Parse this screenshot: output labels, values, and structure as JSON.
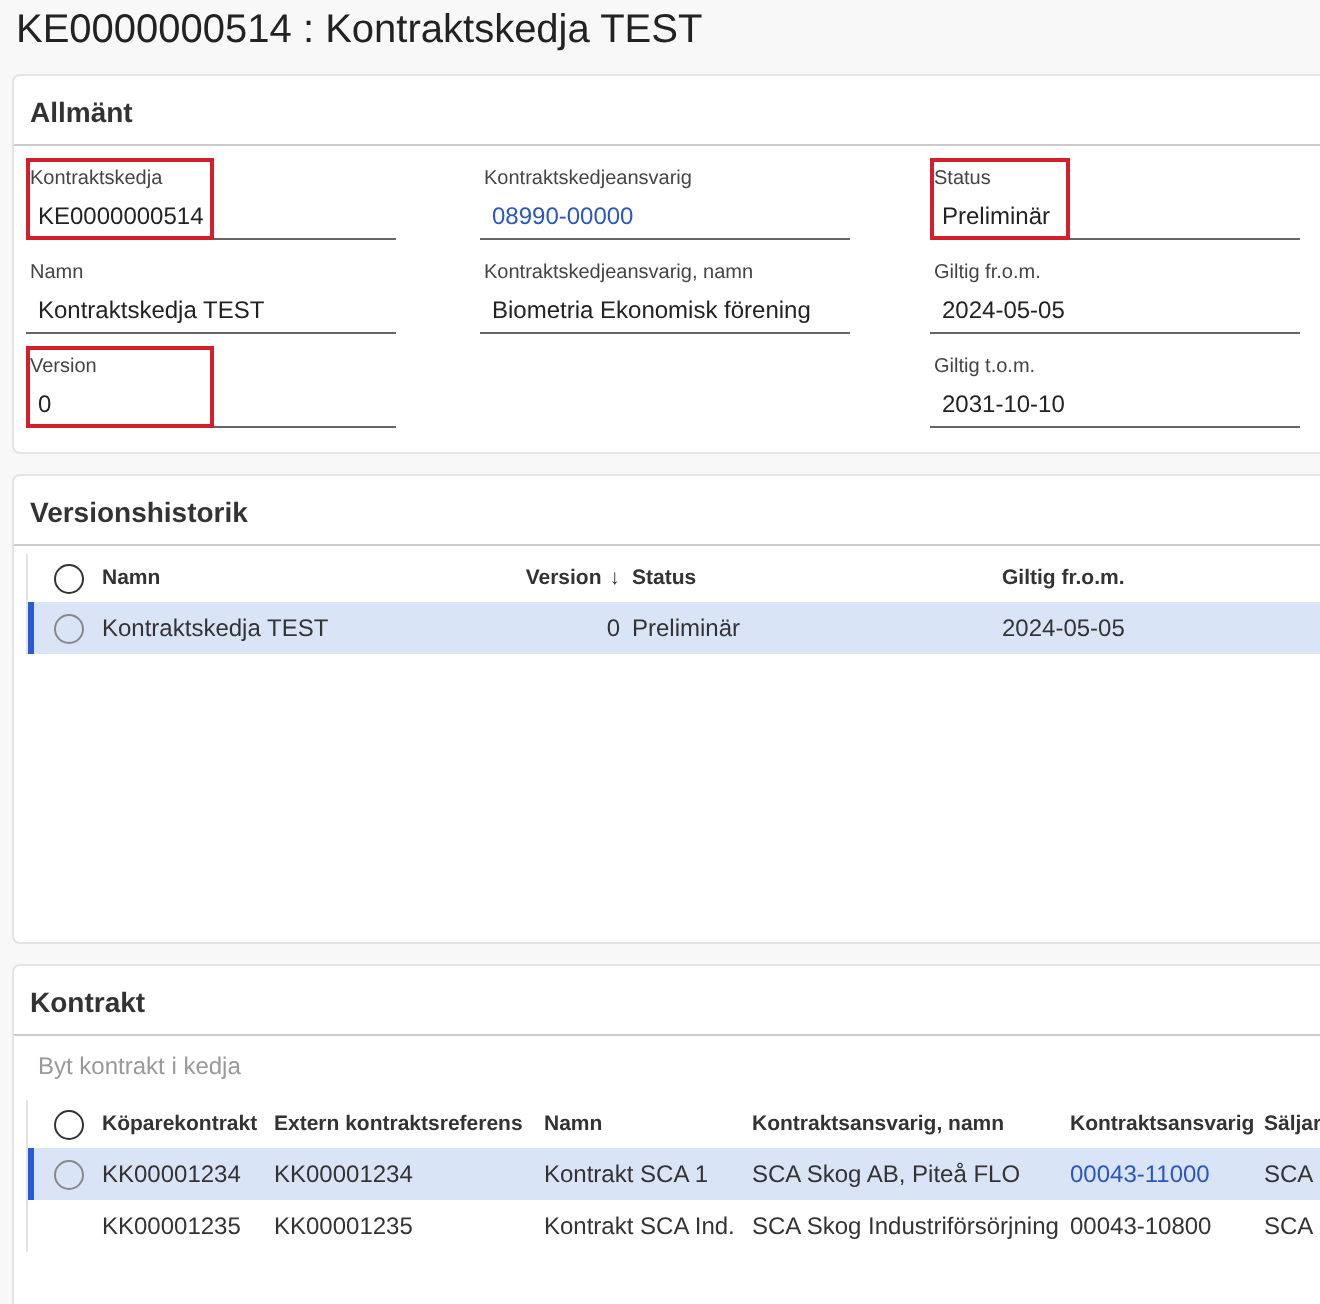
{
  "title": "KE0000000514 : Kontraktskedja TEST",
  "general": {
    "heading": "Allmänt",
    "columns": [
      [
        {
          "label": "Kontraktskedja",
          "value": "KE0000000514",
          "link": false,
          "highlighted": true
        },
        {
          "label": "Namn",
          "value": "Kontraktskedja TEST",
          "link": false,
          "highlighted": false
        },
        {
          "label": "Version",
          "value": "0",
          "link": false,
          "highlighted": true
        }
      ],
      [
        {
          "label": "Kontraktskedjeansvarig",
          "value": "08990-00000",
          "link": true,
          "highlighted": false
        },
        {
          "label": "Kontraktskedjeansvarig, namn",
          "value": "Biometria Ekonomisk förening",
          "link": false,
          "highlighted": false
        }
      ],
      [
        {
          "label": "Status",
          "value": "Preliminär",
          "link": false,
          "highlighted": true
        },
        {
          "label": "Giltig fr.o.m.",
          "value": "2024-05-05",
          "link": false,
          "highlighted": false
        },
        {
          "label": "Giltig t.o.m.",
          "value": "2031-10-10",
          "link": false,
          "highlighted": false
        }
      ]
    ]
  },
  "versions": {
    "heading": "Versionshistorik",
    "all_selected": false,
    "columns": [
      {
        "label": "Namn"
      },
      {
        "label": "Version",
        "sort": "↓"
      },
      {
        "label": "Status"
      },
      {
        "label": "Giltig fr.o.m."
      }
    ],
    "rows": [
      {
        "selected": true,
        "cells": [
          "Kontraktskedja TEST",
          "0",
          "Preliminär",
          "2024-05-05"
        ]
      }
    ]
  },
  "contracts": {
    "heading": "Kontrakt",
    "action": "Byt kontrakt i kedja",
    "all_selected": false,
    "columns": [
      "Köparekontrakt",
      "Extern kontraktsreferens",
      "Namn",
      "Kontraktsansvarig, namn",
      "Kontraktsansvarig",
      "Säljar"
    ],
    "rows": [
      {
        "selected": true,
        "cells": [
          {
            "text": "KK00001234",
            "link": false
          },
          {
            "text": "KK00001234",
            "link": false
          },
          {
            "text": "Kontrakt SCA 1",
            "link": false
          },
          {
            "text": "SCA Skog AB, Piteå FLO",
            "link": false
          },
          {
            "text": "00043-11000",
            "link": true
          },
          {
            "text": "SCA",
            "link": false
          }
        ]
      },
      {
        "selected": false,
        "cells": [
          {
            "text": "KK00001235",
            "link": false
          },
          {
            "text": "KK00001235",
            "link": false
          },
          {
            "text": "Kontrakt SCA Ind.",
            "link": false
          },
          {
            "text": "SCA Skog Industriförsörjning",
            "link": false
          },
          {
            "text": "00043-10800",
            "link": false
          },
          {
            "text": "SCA",
            "link": false
          }
        ]
      }
    ]
  }
}
